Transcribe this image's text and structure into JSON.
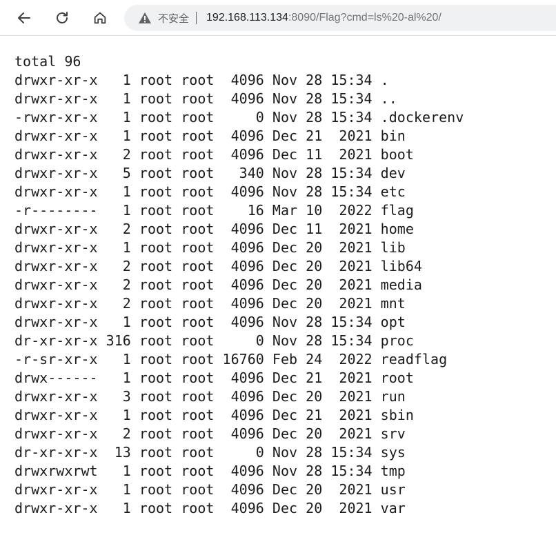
{
  "browser": {
    "security_label": "不安全",
    "url_host": "192.168.113.134",
    "url_rest": ":8090/Flag?cmd=ls%20-al%20/"
  },
  "listing": {
    "total": "total 96",
    "lines": [
      "drwxr-xr-x   1 root root  4096 Nov 28 15:34 .",
      "drwxr-xr-x   1 root root  4096 Nov 28 15:34 ..",
      "-rwxr-xr-x   1 root root     0 Nov 28 15:34 .dockerenv",
      "drwxr-xr-x   1 root root  4096 Dec 21  2021 bin",
      "drwxr-xr-x   2 root root  4096 Dec 11  2021 boot",
      "drwxr-xr-x   5 root root   340 Nov 28 15:34 dev",
      "drwxr-xr-x   1 root root  4096 Nov 28 15:34 etc",
      "-r--------   1 root root    16 Mar 10  2022 flag",
      "drwxr-xr-x   2 root root  4096 Dec 11  2021 home",
      "drwxr-xr-x   1 root root  4096 Dec 20  2021 lib",
      "drwxr-xr-x   2 root root  4096 Dec 20  2021 lib64",
      "drwxr-xr-x   2 root root  4096 Dec 20  2021 media",
      "drwxr-xr-x   2 root root  4096 Dec 20  2021 mnt",
      "drwxr-xr-x   1 root root  4096 Nov 28 15:34 opt",
      "dr-xr-xr-x 316 root root     0 Nov 28 15:34 proc",
      "-r-sr-xr-x   1 root root 16760 Feb 24  2022 readflag",
      "drwx------   1 root root  4096 Dec 21  2021 root",
      "drwxr-xr-x   3 root root  4096 Dec 20  2021 run",
      "drwxr-xr-x   1 root root  4096 Dec 21  2021 sbin",
      "drwxr-xr-x   2 root root  4096 Dec 20  2021 srv",
      "dr-xr-xr-x  13 root root     0 Nov 28 15:34 sys",
      "drwxrwxrwt   1 root root  4096 Nov 28 15:34 tmp",
      "drwxr-xr-x   1 root root  4096 Dec 20  2021 usr",
      "drwxr-xr-x   1 root root  4096 Dec 20  2021 var"
    ]
  }
}
